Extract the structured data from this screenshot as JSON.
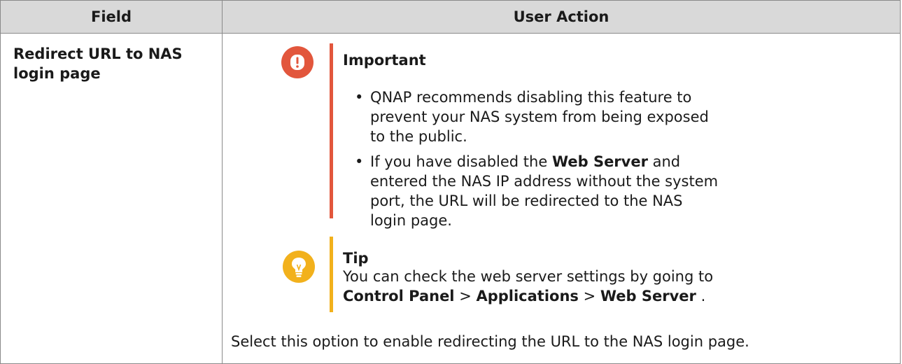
{
  "table": {
    "headers": [
      "Field",
      "User Action"
    ]
  },
  "row": {
    "field": "Redirect URL to NAS login page",
    "important": {
      "title": "Important",
      "bullets": [
        "QNAP recommends disabling this feature to prevent your NAS system from being exposed to the public.",
        {
          "before": "If you have disabled the ",
          "bold": "Web Server",
          "after": " and entered the NAS IP address without the system port, the URL will be redirected to the NAS login page."
        }
      ],
      "icon": "exclamation-circle-icon",
      "color": "#e2563c"
    },
    "tip": {
      "title": "Tip",
      "line1": "You can check the web server settings by going to",
      "path": [
        "Control Panel",
        "Applications",
        "Web Server"
      ],
      "separator": " > ",
      "trailing": " .",
      "icon": "lightbulb-icon",
      "color": "#f2b11c"
    },
    "description": "Select this option to enable redirecting the URL to the NAS login page."
  },
  "bullet_glyph": "•"
}
